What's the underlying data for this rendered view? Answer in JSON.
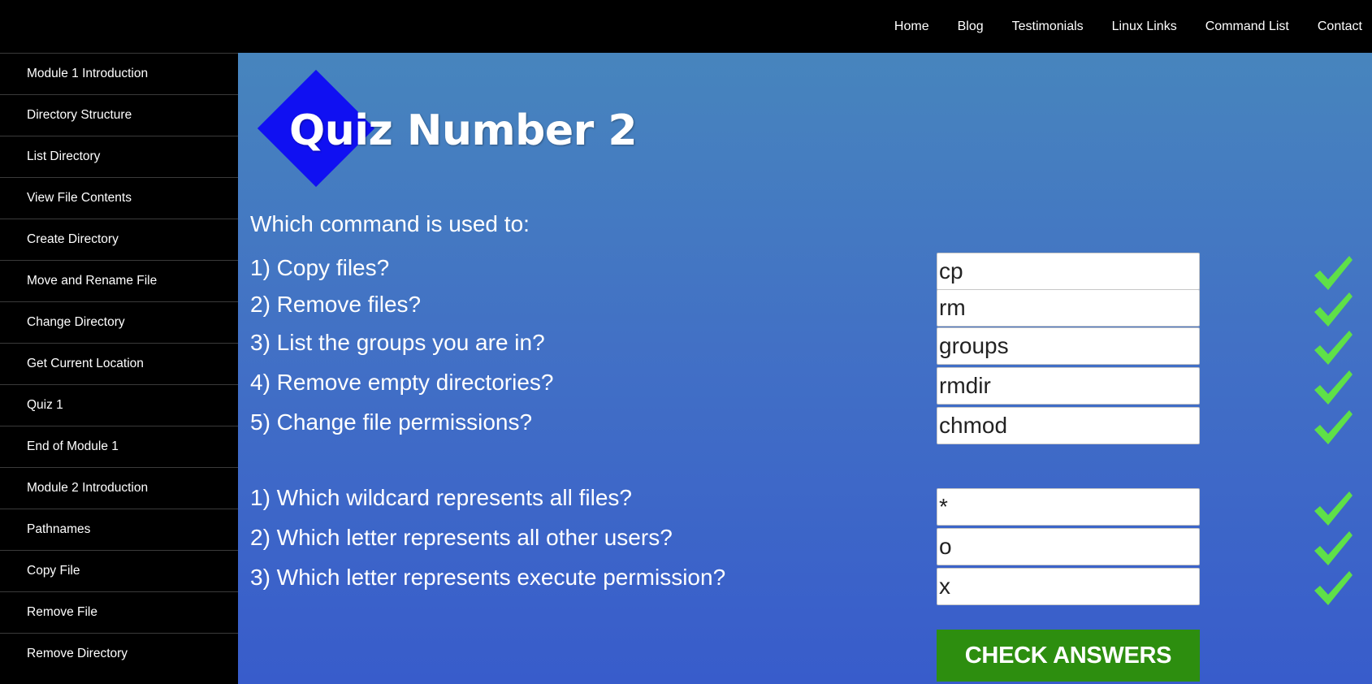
{
  "topnav": [
    "Home",
    "Blog",
    "Testimonials",
    "Linux Links",
    "Command List",
    "Contact"
  ],
  "sidebar": {
    "items": [
      "Module 1 Introduction",
      "Directory Structure",
      "List Directory",
      "View File Contents",
      "Create Directory",
      "Move and Rename File",
      "Change Directory",
      "Get Current Location",
      "Quiz 1",
      "End of Module 1",
      "Module 2 Introduction",
      "Pathnames",
      "Copy File",
      "Remove File",
      "Remove Directory"
    ]
  },
  "quiz": {
    "title": "Quiz Number 2",
    "intro": "Which command is used to:",
    "questions": [
      {
        "label": "1) Copy files?",
        "answer": "cp",
        "status": "correct"
      },
      {
        "label": "2) Remove files?",
        "answer": "rm",
        "status": "correct"
      },
      {
        "label": "3) List the groups you are in?",
        "answer": "groups",
        "status": "correct"
      },
      {
        "label": "4) Remove empty directories?",
        "answer": "rmdir",
        "status": "correct"
      },
      {
        "label": "5) Change file permissions?",
        "answer": "chmod",
        "status": "correct"
      },
      {
        "label": "1) Which wildcard represents all files?",
        "answer": "*",
        "status": "correct"
      },
      {
        "label": "2) Which letter represents all other users?",
        "answer": "o",
        "status": "correct"
      },
      {
        "label": "3) Which letter represents execute permission?",
        "answer": "x",
        "status": "correct"
      }
    ],
    "check_button": "CHECK ANSWERS"
  },
  "colors": {
    "check_mark": "#5fe048",
    "logo_diamond": "#1010f2",
    "button_green": "#2d8e0f"
  },
  "icons": {
    "correct": "checkmark-icon"
  }
}
